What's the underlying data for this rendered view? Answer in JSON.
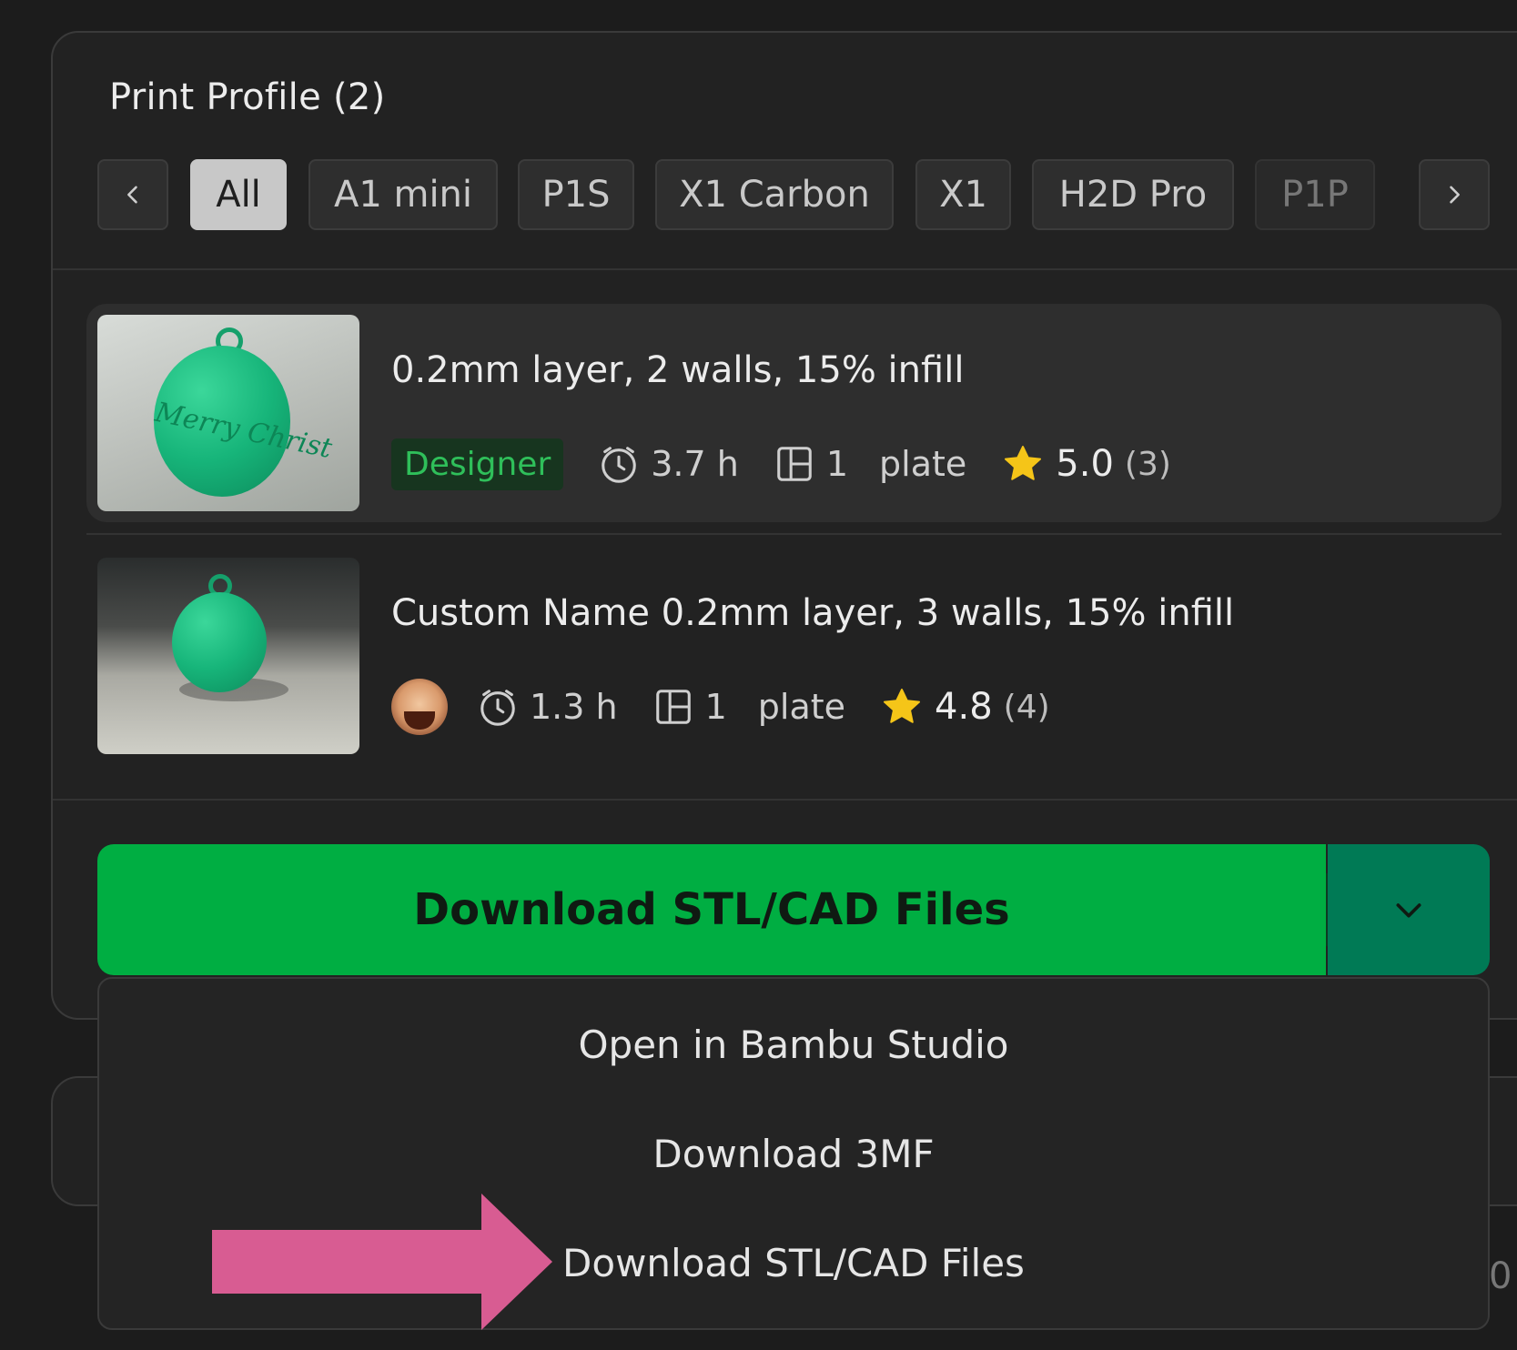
{
  "section": {
    "title": "Print Profile (2)"
  },
  "chips": [
    {
      "label": "All",
      "active": true
    },
    {
      "label": "A1 mini",
      "active": false
    },
    {
      "label": "P1S",
      "active": false
    },
    {
      "label": "X1 Carbon",
      "active": false
    },
    {
      "label": "X1",
      "active": false
    },
    {
      "label": "H2D Pro",
      "active": false
    },
    {
      "label": "P1P",
      "active": false
    }
  ],
  "profiles": [
    {
      "title": "0.2mm layer, 2 walls, 15% infill",
      "badge": "Designer",
      "time": "3.7 h",
      "plates": "1",
      "plate_word": "plate",
      "rating": "5.0",
      "rating_count": "(3)",
      "selected": true
    },
    {
      "title": "Custom Name 0.2mm layer, 3 walls, 15% infill",
      "time": "1.3 h",
      "plates": "1",
      "plate_word": "plate",
      "rating": "4.8",
      "rating_count": "(4)",
      "selected": false
    }
  ],
  "download": {
    "label": "Download STL/CAD Files"
  },
  "menu": {
    "items": [
      "Open in Bambu Studio",
      "Download 3MF",
      "Download STL/CAD Files"
    ]
  },
  "edge_fragment": "0",
  "colors": {
    "accent_green": "#00ae42",
    "toggle_green": "#007a55",
    "annotation_pink": "#d85c92",
    "star_yellow": "#f5c518"
  },
  "icons": [
    "chevron-left-icon",
    "chevron-right-icon",
    "clock-icon",
    "plate-icon",
    "star-icon",
    "chevron-down-icon",
    "arrow-annotation"
  ]
}
